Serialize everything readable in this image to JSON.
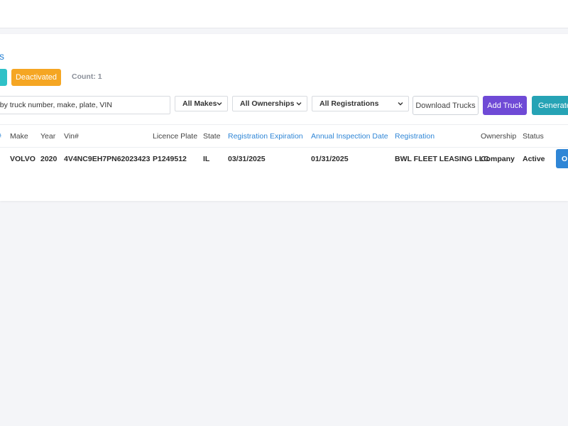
{
  "page": {
    "title": "s"
  },
  "filters": {
    "active_label": "",
    "deactivated_label": "Deactivated",
    "count_label": "Count: 1"
  },
  "toolbar": {
    "search_placeholder": "h by truck number, make, plate, VIN",
    "makes_select": "All Makes",
    "ownerships_select": "All Ownerships",
    "registrations_select": "All Registrations",
    "download_label": "Download Trucks",
    "add_label": "Add Truck",
    "generate_label": "Generate"
  },
  "table": {
    "columns": {
      "first": "#",
      "make": "Make",
      "year": "Year",
      "vin": "Vin#",
      "plate": "Licence Plate",
      "state": "State",
      "reg_exp": "Registration Expiration",
      "inspection": "Annual Inspection Date",
      "registration": "Registration",
      "ownership": "Ownership",
      "status": "Status"
    },
    "rows": [
      {
        "make": "VOLVO",
        "year": "2020",
        "vin": "4V4NC9EH7PN62023423",
        "plate": "P1249512",
        "state": "IL",
        "reg_exp": "03/31/2025",
        "inspection": "01/31/2025",
        "registration": "BWL FLEET LEASING LLC",
        "ownership": "Company",
        "status": "Active",
        "action_label": "O"
      }
    ]
  }
}
